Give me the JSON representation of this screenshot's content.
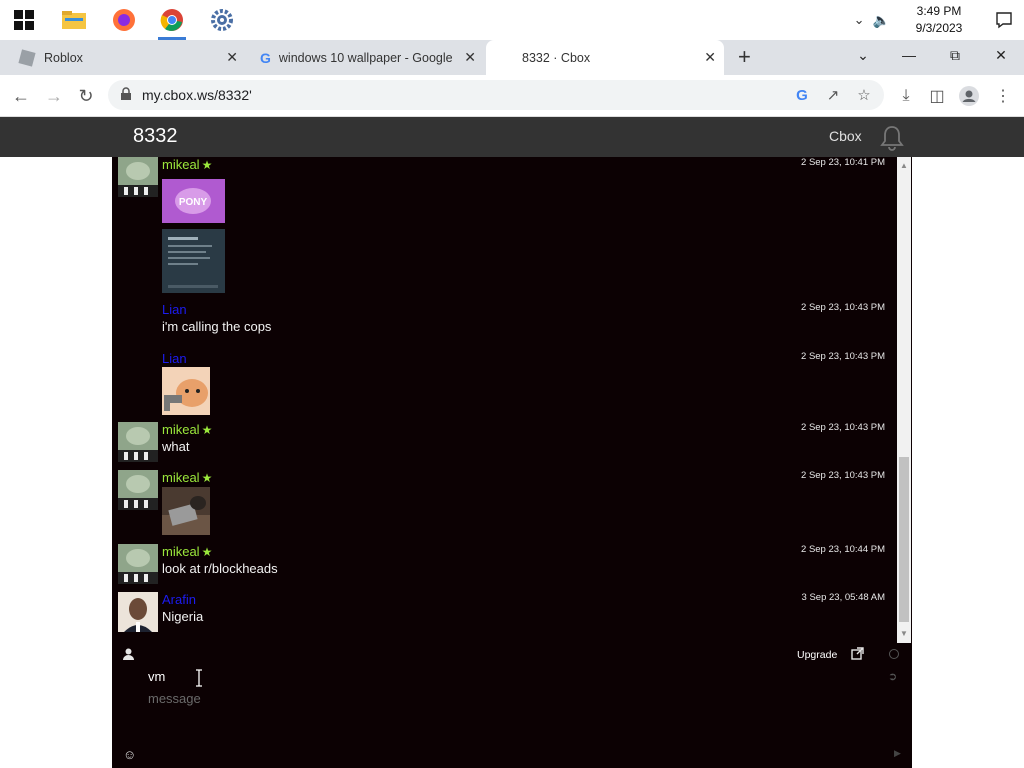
{
  "taskbar": {
    "time": "3:49 PM",
    "date": "9/3/2023"
  },
  "browser": {
    "tabs": [
      {
        "label": "Roblox"
      },
      {
        "label": "windows 10 wallpaper - Google S"
      },
      {
        "label": "8332 · Cbox"
      }
    ],
    "url": "my.cbox.ws/8332'"
  },
  "cbox": {
    "room_title": "8332",
    "brand": "Cbox",
    "messages": [
      {
        "name": "mikeal",
        "time": "2 Sep 23, 10:41 PM",
        "text": ""
      },
      {
        "name": "Lian",
        "time": "2 Sep 23, 10:43 PM",
        "text": "i'm calling the cops"
      },
      {
        "name": "Lian",
        "time": "2 Sep 23, 10:43 PM",
        "text": ""
      },
      {
        "name": "mikeal",
        "time": "2 Sep 23, 10:43 PM",
        "text": "what"
      },
      {
        "name": "mikeal",
        "time": "2 Sep 23, 10:43 PM",
        "text": ""
      },
      {
        "name": "mikeal",
        "time": "2 Sep 23, 10:44 PM",
        "text": "look at r/blockheads"
      },
      {
        "name": "Arafin",
        "time": "3 Sep 23, 05:48 AM",
        "text": "Nigeria"
      }
    ],
    "composer": {
      "upgrade_label": "Upgrade",
      "name_value": "vm",
      "message_placeholder": "message"
    }
  },
  "colors": {
    "chat_bg": "#0c0103",
    "header_bg": "#333333",
    "member_name": "#9be83c",
    "guest_name": "#1c1cf0"
  }
}
